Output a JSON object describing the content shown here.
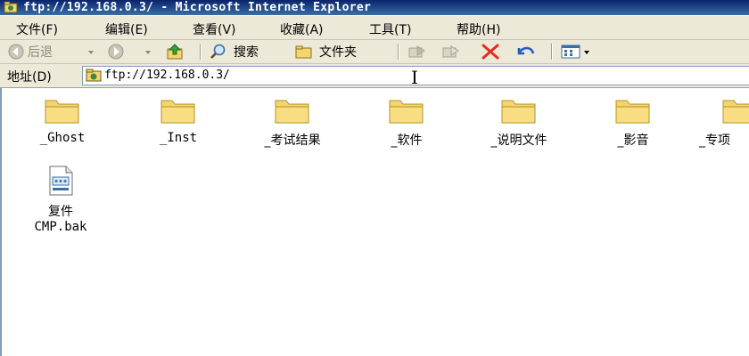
{
  "window": {
    "title": "ftp://192.168.0.3/ - Microsoft Internet Explorer"
  },
  "menu": [
    {
      "label": "文件(F)"
    },
    {
      "label": "编辑(E)"
    },
    {
      "label": "查看(V)"
    },
    {
      "label": "收藏(A)"
    },
    {
      "label": "工具(T)"
    },
    {
      "label": "帮助(H)"
    }
  ],
  "toolbar": {
    "back_label": "后退",
    "search_label": "搜索",
    "folders_label": "文件夹"
  },
  "address": {
    "label": "地址(D)",
    "value": "ftp://192.168.0.3/"
  },
  "folders": [
    {
      "name": "_Ghost"
    },
    {
      "name": "_Inst"
    },
    {
      "name": "_考试结果"
    },
    {
      "name": "_软件"
    },
    {
      "name": "_说明文件"
    },
    {
      "name": "_影音"
    },
    {
      "name": "_专项"
    }
  ],
  "files": [
    {
      "name_line1": "复件",
      "name_line2": "CMP.bak"
    }
  ],
  "colors": {
    "titlebar": "#0a246a",
    "folder": "#f4d470",
    "delete": "#e0301e"
  }
}
